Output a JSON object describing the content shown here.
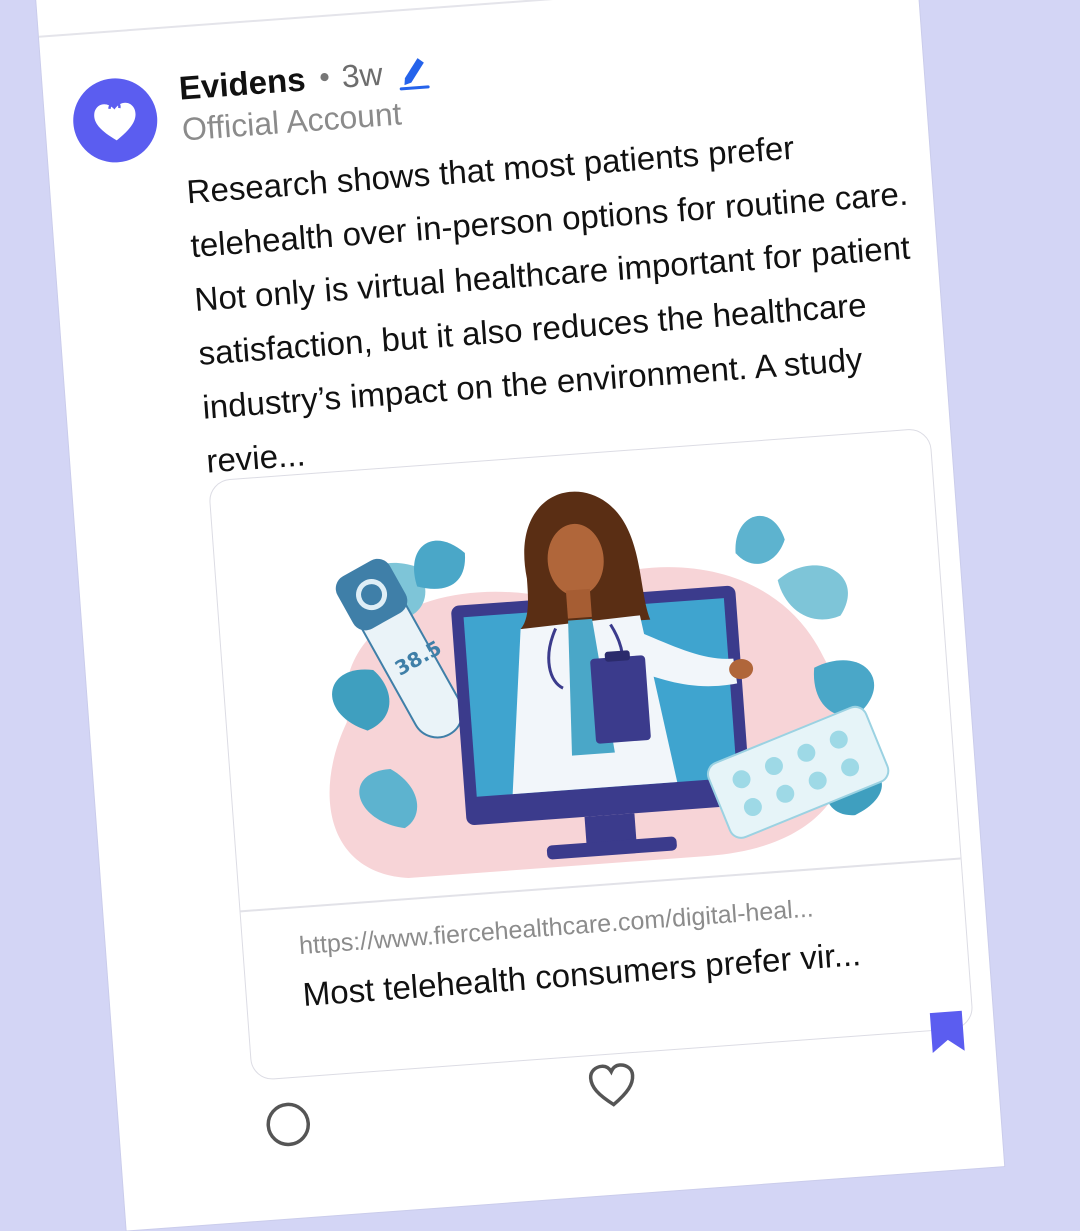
{
  "post": {
    "author": "Evidens",
    "separator": "•",
    "age": "3w",
    "account_type": "Official Account",
    "text": "Research shows that most patients prefer telehealth over in-person options for routine care. Not only is virtual healthcare important for patient satisfaction, but it also reduces the healthcare industry’s impact on the environment. A study revie..."
  },
  "link_preview": {
    "thermometer_reading": "38.5",
    "url": "https://www.fiercehealthcare.com/digital-heal...",
    "title": "Most telehealth consumers prefer vir..."
  },
  "actions": {
    "comment_icon": "comment-icon",
    "like_icon": "heart-icon",
    "bookmark_icon": "bookmark-icon"
  },
  "colors": {
    "background": "#d3d5f5",
    "brand": "#5b5df0",
    "edit_icon": "#2563eb"
  }
}
